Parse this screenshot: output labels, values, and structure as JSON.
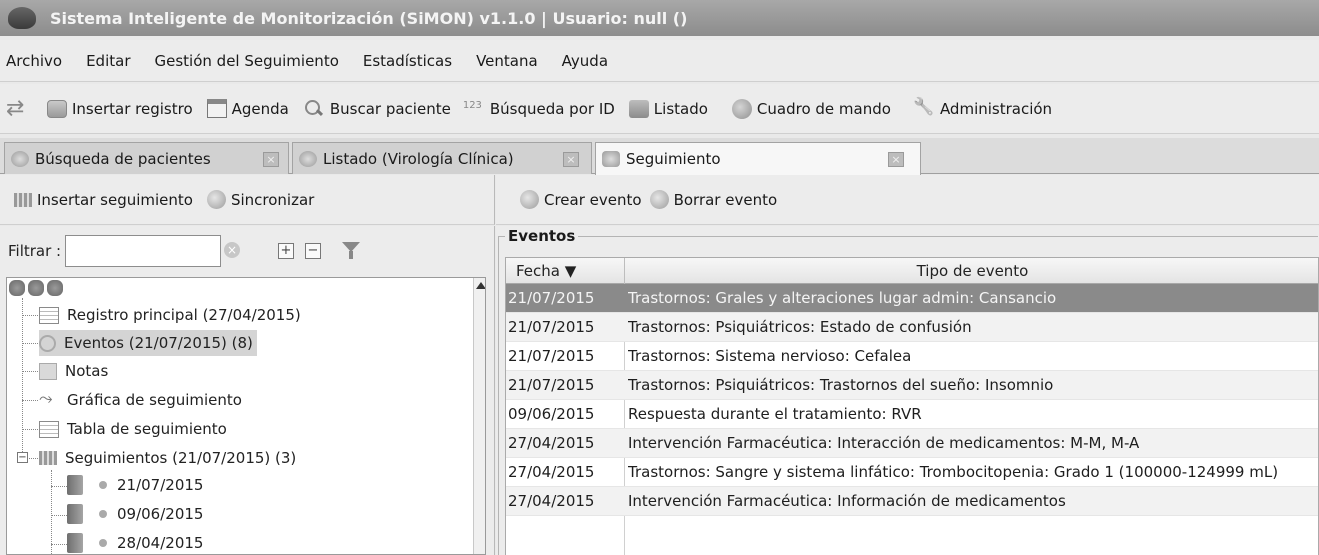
{
  "window": {
    "title": "Sistema Inteligente de Monitorización (SiMON) v1.1.0 | Usuario: null ()"
  },
  "menu": [
    "Archivo",
    "Editar",
    "Gestión del Seguimiento",
    "Estadísticas",
    "Ventana",
    "Ayuda"
  ],
  "toolbar": {
    "insert": "Insertar registro",
    "agenda": "Agenda",
    "search": "Buscar paciente",
    "search_id": "Búsqueda por ID",
    "list": "Listado",
    "dashboard": "Cuadro de mando",
    "admin": "Administración"
  },
  "tabs": [
    {
      "label": "Búsqueda de pacientes"
    },
    {
      "label": "Listado (Virología Clínica)"
    },
    {
      "label": "Seguimiento",
      "active": true
    }
  ],
  "left_toolbar": {
    "insert": "Insertar seguimiento",
    "sync": "Sincronizar"
  },
  "right_toolbar": {
    "create": "Crear evento",
    "delete": "Borrar evento"
  },
  "filter": {
    "label": "Filtrar :",
    "value": ""
  },
  "tree": {
    "items": [
      "Registro principal (27/04/2015)",
      "Eventos (21/07/2015) (8)",
      "Notas",
      "Gráfica de seguimiento",
      "Tabla de seguimiento",
      "Seguimientos (21/07/2015) (3)"
    ],
    "children": [
      "21/07/2015",
      "09/06/2015",
      "28/04/2015"
    ]
  },
  "events": {
    "title": "Eventos",
    "columns": {
      "date": "Fecha ▼",
      "type": "Tipo de evento"
    },
    "rows": [
      {
        "date": "21/07/2015",
        "type": "Trastornos: Grales y alteraciones lugar admin: Cansancio"
      },
      {
        "date": "21/07/2015",
        "type": "Trastornos: Psiquiátricos: Estado de confusión"
      },
      {
        "date": "21/07/2015",
        "type": "Trastornos: Sistema nervioso: Cefalea"
      },
      {
        "date": "21/07/2015",
        "type": "Trastornos: Psiquiátricos: Trastornos del sueño: Insomnio"
      },
      {
        "date": "09/06/2015",
        "type": "Respuesta durante el tratamiento: RVR"
      },
      {
        "date": "27/04/2015",
        "type": "Intervención Farmacéutica: Interacción de medicamentos: M-M, M-A"
      },
      {
        "date": "27/04/2015",
        "type": "Trastornos: Sangre y sistema linfático: Trombocitopenia: Grado 1 (100000-124999 mL)"
      },
      {
        "date": "27/04/2015",
        "type": "Intervención Farmacéutica: Información de medicamentos"
      }
    ]
  }
}
